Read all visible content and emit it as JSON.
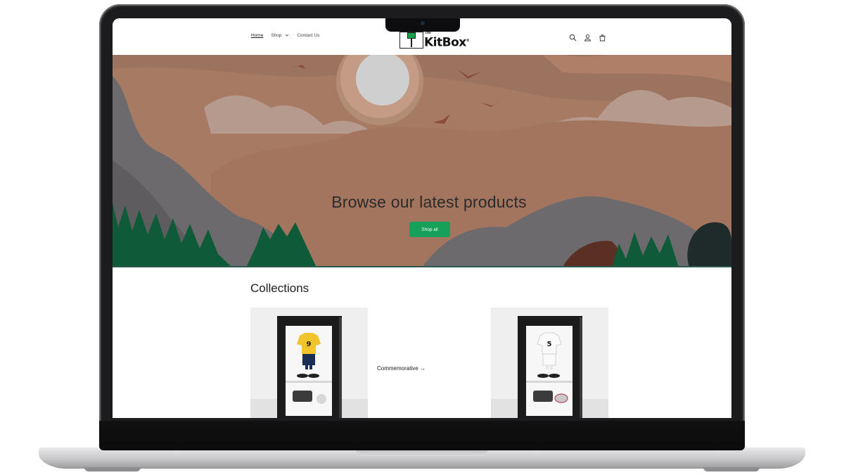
{
  "nav": {
    "home": "Home",
    "shop": "Shop",
    "contact": "Contact Us"
  },
  "logo": {
    "small": "The",
    "main": "KitBox",
    "mark": "®"
  },
  "hero": {
    "title": "Browse our latest products",
    "button": "Shop all"
  },
  "collections": {
    "title": "Collections",
    "items": [
      {
        "shirt_number": "9",
        "link": ""
      },
      {
        "shirt_number": "",
        "link": "Commemorative →"
      },
      {
        "shirt_number": "5",
        "link": ""
      }
    ]
  },
  "colors": {
    "accent": "#16a05a",
    "hero_sky": "#a77a63",
    "hero_mountain": "#6b6a6b",
    "hero_tree": "#0f5a39"
  },
  "icons": [
    "search-icon",
    "account-icon",
    "cart-icon"
  ]
}
